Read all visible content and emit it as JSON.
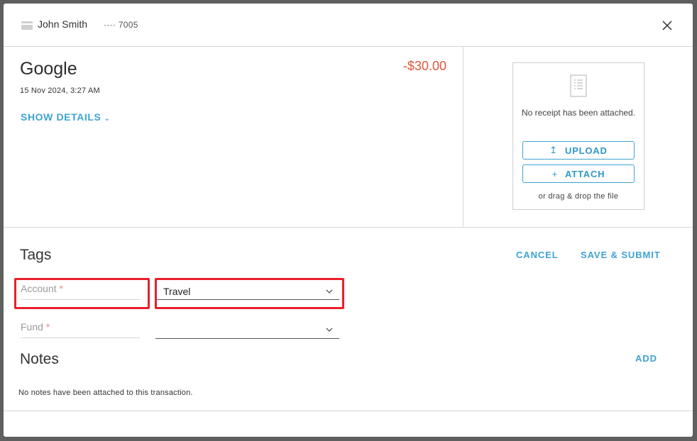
{
  "header": {
    "user_name": "John Smith",
    "card_mask": "···· 7005"
  },
  "transaction": {
    "merchant": "Google",
    "date": "15 Nov 2024, 3:27 AM",
    "amount": "-$30.00",
    "show_details_label": "SHOW DETAILS"
  },
  "receipt": {
    "message": "No receipt has been attached.",
    "upload_label": "UPLOAD",
    "attach_label": "ATTACH",
    "drag_text": "or drag & drop the file"
  },
  "tags": {
    "title": "Tags",
    "cancel_label": "CANCEL",
    "save_submit_label": "SAVE & SUBMIT",
    "fields": [
      {
        "label": "Account",
        "required_mark": "*",
        "value": "Travel"
      },
      {
        "label": "Fund",
        "required_mark": "*",
        "value": ""
      }
    ]
  },
  "notes": {
    "title": "Notes",
    "add_label": "ADD",
    "empty_text": "No notes have been attached to this transaction."
  },
  "colors": {
    "accent": "#3fa3d2",
    "amount_negative": "#e0553a",
    "highlight": "#e8202a"
  }
}
